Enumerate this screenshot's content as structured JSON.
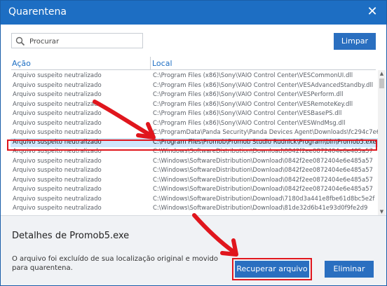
{
  "window": {
    "title": "Quarentena",
    "close_symbol": "✕"
  },
  "search": {
    "placeholder": "Procurar"
  },
  "toolbar": {
    "clear_label": "Limpar"
  },
  "table": {
    "columns": {
      "action": "Ação",
      "location": "Local"
    },
    "rows": [
      {
        "action": "Arquivo suspeito neutralizado",
        "location": "C:\\Program Files (x86)\\Sony\\VAIO Control Center\\VESCommonUI.dll"
      },
      {
        "action": "Arquivo suspeito neutralizado",
        "location": "C:\\Program Files (x86)\\Sony\\VAIO Control Center\\VESAdvancedStandby.dll"
      },
      {
        "action": "Arquivo suspeito neutralizado",
        "location": "C:\\Program Files (x86)\\Sony\\VAIO Control Center\\VESPerform.dll"
      },
      {
        "action": "Arquivo suspeito neutralizado",
        "location": "C:\\Program Files (x86)\\Sony\\VAIO Control Center\\VESRemoteKey.dll"
      },
      {
        "action": "Arquivo suspeito neutralizado",
        "location": "C:\\Program Files (x86)\\Sony\\VAIO Control Center\\VESBasePS.dll"
      },
      {
        "action": "Arquivo suspeito neutralizado",
        "location": "C:\\Program Files (x86)\\Sony\\VAIO Control Center\\VESWndMsg.dll"
      },
      {
        "action": "Arquivo suspeito neutralizado",
        "location": "C:\\ProgramData\\Panda Security\\Panda Devices Agent\\Downloads\\fc294c7e6"
      },
      {
        "action": "Arquivo suspeito neutralizado",
        "location": "C:\\Program Files\\Promob\\Promob Studio Rudnick\\Program\\bin\\Promob5.exe"
      },
      {
        "action": "Arquivo suspeito neutralizado",
        "location": "C:\\Windows\\SoftwareDistribution\\Download\\0842f2ee0872404e6e485a57"
      },
      {
        "action": "Arquivo suspeito neutralizado",
        "location": "C:\\Windows\\SoftwareDistribution\\Download\\0842f2ee0872404e6e485a57"
      },
      {
        "action": "Arquivo suspeito neutralizado",
        "location": "C:\\Windows\\SoftwareDistribution\\Download\\0842f2ee0872404e6e485a57"
      },
      {
        "action": "Arquivo suspeito neutralizado",
        "location": "C:\\Windows\\SoftwareDistribution\\Download\\0842f2ee0872404e6e485a57"
      },
      {
        "action": "Arquivo suspeito neutralizado",
        "location": "C:\\Windows\\SoftwareDistribution\\Download\\0842f2ee0872404e6e485a57"
      },
      {
        "action": "Arquivo suspeito neutralizado",
        "location": "C:\\Windows\\SoftwareDistribution\\Download\\7180d3a441e8fbe61d8bc5e2f"
      },
      {
        "action": "Arquivo suspeito neutralizado",
        "location": "C:\\Windows\\SoftwareDistribution\\Download\\81de32d6b41e93d0f9fe2d9"
      }
    ],
    "selected_index": 7
  },
  "details": {
    "title": "Detalhes de Promob5.exe",
    "description": "O arquivo foi excluído de sua localização original e movido para quarentena."
  },
  "actions": {
    "recover_label": "Recuperar arquivo",
    "delete_label": "Eliminar"
  },
  "colors": {
    "accent": "#1d6ec3",
    "highlight": "#e0161d",
    "selected_row": "#cfe6fb"
  }
}
